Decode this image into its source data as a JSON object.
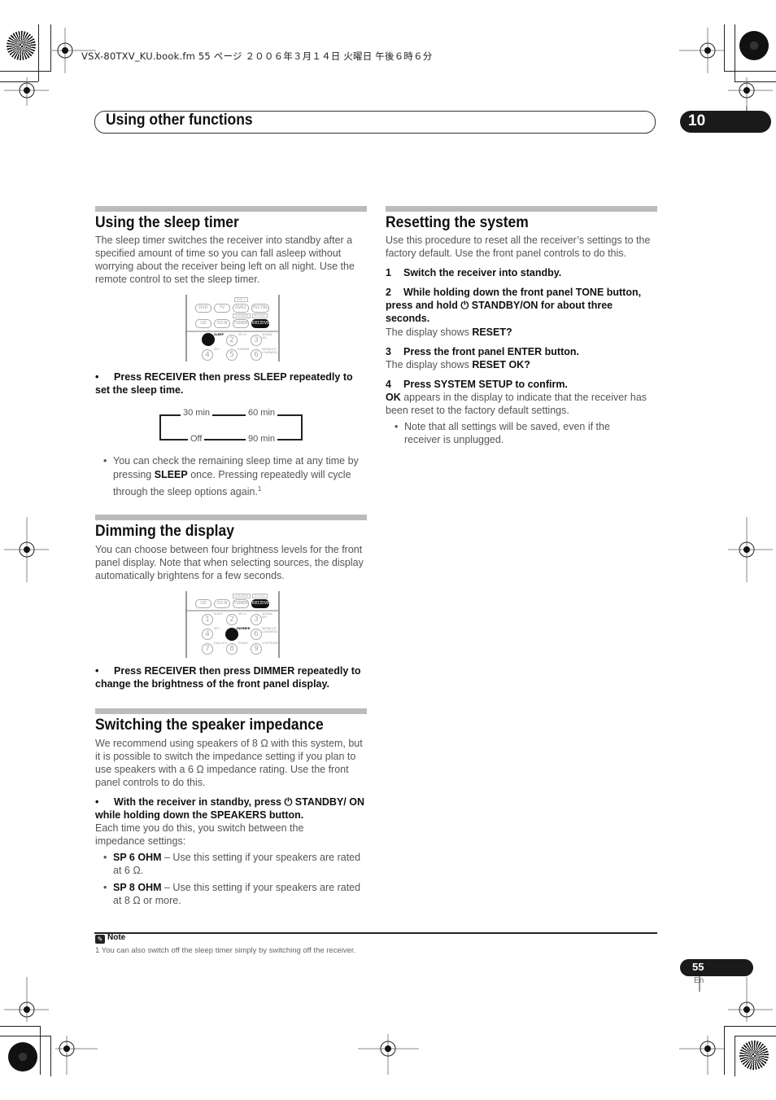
{
  "file_header": "VSX-80TXV_KU.book.fm  55 ページ  ２００６年３月１４日  火曜日  午後６時６分",
  "chapter": {
    "title": "Using other functions",
    "number": "10"
  },
  "sleep_timer": {
    "heading": "Using the sleep timer",
    "intro": "The sleep timer switches the receiver into standby after a specified amount of time so you can fall asleep without worrying about the receiver being left on all night. Use the remote control to set the sleep timer.",
    "remote": {
      "top_label": "DVR 2",
      "row1": [
        "DVD",
        "TV",
        "DVR1",
        "TVCTRL"
      ],
      "row2_labels": [
        "DVR/BDR",
        "ROOM2"
      ],
      "row2": [
        "CD",
        "CD-R",
        "TUNER",
        "RECEIVER"
      ],
      "active_button": "RECEIVER",
      "numbers": [
        "1",
        "2",
        "3",
        "4",
        "5",
        "6"
      ],
      "number_labels": [
        "SLEEP",
        "SB ch",
        "SIGNAL SEL",
        "SR+",
        "DIMMER",
        "MIDNIGHT LOUDNESS"
      ],
      "active_number_label": "SLEEP"
    },
    "instruction_prefix": "•",
    "instruction": "Press RECEIVER then press SLEEP repeatedly to set the sleep time.",
    "cycle": [
      "30 min",
      "60 min",
      "90 min",
      "Off"
    ],
    "note_bullet_pre": "You can check the remaining sleep time at any time by pressing ",
    "note_bullet_key": "SLEEP",
    "note_bullet_post": " once. Pressing repeatedly will cycle through the sleep options again.",
    "footnote_ref": "1"
  },
  "dimming": {
    "heading": "Dimming the display",
    "intro": "You can choose between four brightness levels for the front panel display. Note that when selecting sources, the display automatically brightens for a few seconds.",
    "remote": {
      "row2_labels": [
        "DVR/BDR",
        "ROOM2"
      ],
      "row2": [
        "CD",
        "CD-R",
        "TUNER",
        "RECEIVER"
      ],
      "active_button": "RECEIVER",
      "numbers": [
        "1",
        "2",
        "3",
        "4",
        "5",
        "6",
        "7",
        "8",
        "9"
      ],
      "number_labels": [
        "SLEEP",
        "SB ch",
        "SIGNAL SEL",
        "SR+",
        "DIMMER",
        "MIDNIGHT LOUDNESS",
        "DIALOG E",
        "PHASE",
        "S.RETRIEVER"
      ],
      "active_number_label": "DIMMER"
    },
    "instruction_prefix": "•",
    "instruction": "Press RECEIVER then press DIMMER repeatedly to change the brightness of the front panel display."
  },
  "impedance": {
    "heading": "Switching the speaker impedance",
    "intro": "We recommend using speakers of 8 Ω with this system, but it is possible to switch the impedance setting if you plan to use speakers with a 6 Ω impedance rating. Use the front panel controls to do this.",
    "instruction_prefix": "•",
    "instruction": "With the receiver in standby, press ⏻ STANDBY/ ON while holding down the SPEAKERS button.",
    "after": "Each time you do this, you switch between the impedance settings:",
    "options": [
      {
        "key": "SP 6 OHM",
        "text": " – Use this setting if your speakers are rated at 6 Ω."
      },
      {
        "key": "SP 8 OHM",
        "text": " – Use this setting if your speakers are rated at 8 Ω or more."
      }
    ]
  },
  "reset": {
    "heading": "Resetting the system",
    "intro": "Use this procedure to reset all the receiver’s settings to the factory default. Use the front panel controls to do this.",
    "steps": [
      {
        "num": "1",
        "text": "Switch the receiver into standby."
      },
      {
        "num": "2",
        "text": "While holding down the front panel TONE button, press and hold ⏻ STANDBY/ON for about three seconds."
      },
      {
        "num": "3",
        "text": "Press the front panel ENTER button."
      },
      {
        "num": "4",
        "text": "Press SYSTEM SETUP to confirm."
      }
    ],
    "display1_pre": "The display shows ",
    "display1_key": "RESET?",
    "display2_pre": "The display shows ",
    "display2_key": "RESET OK?",
    "ok_key": "OK",
    "ok_text": " appears in the display to indicate that the receiver has been reset to the factory default settings.",
    "bullet": "Note that all settings will be saved, even if the receiver is unplugged."
  },
  "note": {
    "icon": "pencil-icon",
    "title": "Note",
    "text": "1 You can also switch off the sleep timer simply by switching off the receiver."
  },
  "page": {
    "number": "55",
    "lang": "En"
  }
}
